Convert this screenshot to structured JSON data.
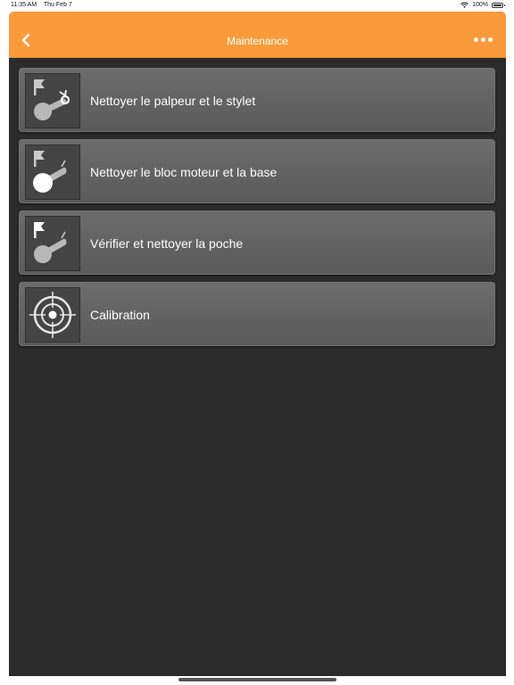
{
  "status_bar": {
    "time": "11:35 AM",
    "date": "Thu Feb 7",
    "battery": "100%",
    "wifi_icon": "wifi-icon",
    "battery_icon": "battery-icon"
  },
  "nav": {
    "title": "Maintenance",
    "back_icon": "chevron-left-icon",
    "more_icon": "more-icon",
    "accent_color": "#f99b3a"
  },
  "items": [
    {
      "label": "Nettoyer le palpeur et le stylet",
      "icon": "probe-stylus-icon"
    },
    {
      "label": "Nettoyer le bloc moteur et la base",
      "icon": "motor-base-icon"
    },
    {
      "label": "Vérifier et nettoyer la poche",
      "icon": "pocket-icon"
    },
    {
      "label": "Calibration",
      "icon": "target-icon"
    }
  ]
}
